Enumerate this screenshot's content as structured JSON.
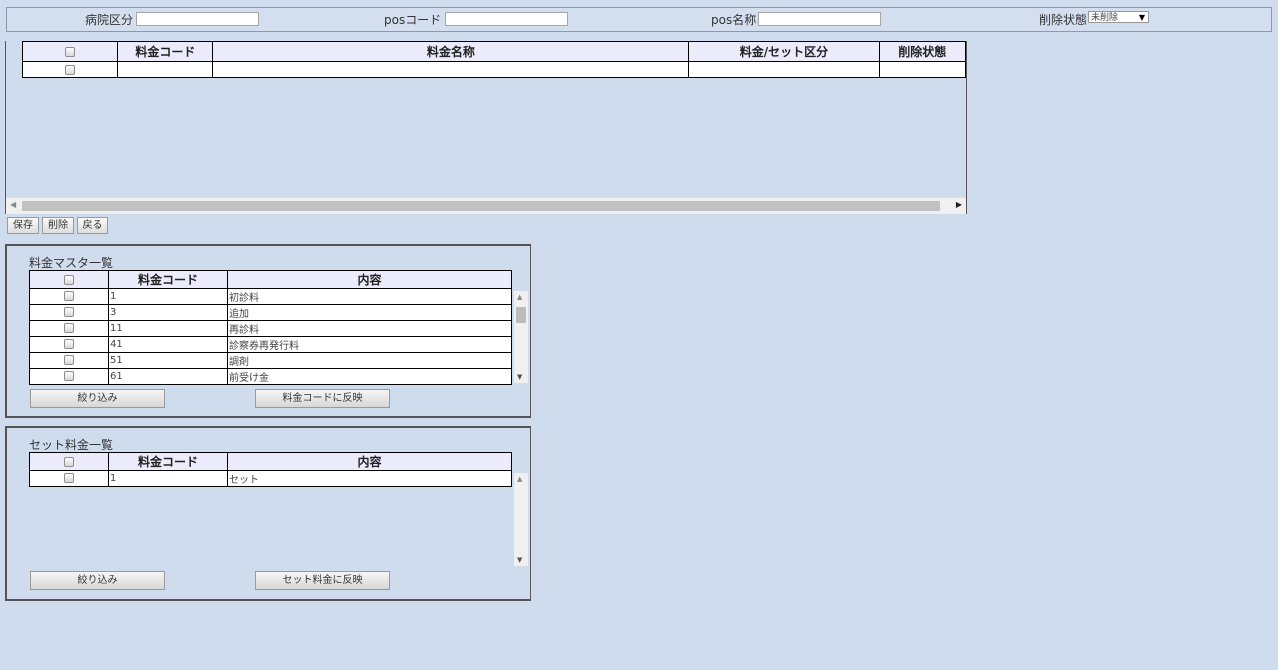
{
  "filters": {
    "hospital_label": "病院区分",
    "pos_code_label": "posコード",
    "pos_name_label": "pos名称",
    "delete_status_label": "削除状態",
    "delete_status_value": "未削除"
  },
  "main_grid": {
    "columns": [
      "料金コード",
      "料金名称",
      "料金/セット区分",
      "削除状態"
    ]
  },
  "buttons": {
    "save": "保存",
    "delete": "削除",
    "back": "戻る"
  },
  "fee_master": {
    "title": "料金マスタ一覧",
    "columns": [
      "料金コード",
      "内容"
    ],
    "rows": [
      {
        "code": "1",
        "content": "初診料"
      },
      {
        "code": "3",
        "content": "追加"
      },
      {
        "code": "11",
        "content": "再診料"
      },
      {
        "code": "41",
        "content": "診察券再発行料"
      },
      {
        "code": "51",
        "content": "調剤"
      },
      {
        "code": "61",
        "content": "前受け金"
      }
    ],
    "filter_button": "絞り込み",
    "apply_button": "料金コードに反映"
  },
  "set_fee": {
    "title": "セット料金一覧",
    "columns": [
      "料金コード",
      "内容"
    ],
    "rows": [
      {
        "code": "1",
        "content": "セット"
      }
    ],
    "filter_button": "絞り込み",
    "apply_button": "セット料金に反映"
  },
  "icons": {
    "dropdown": "triangle-down-icon",
    "scroll_left": "arrow-left-icon",
    "scroll_right": "arrow-right-icon",
    "scroll_up": "arrow-up-icon",
    "scroll_down": "arrow-down-icon"
  }
}
